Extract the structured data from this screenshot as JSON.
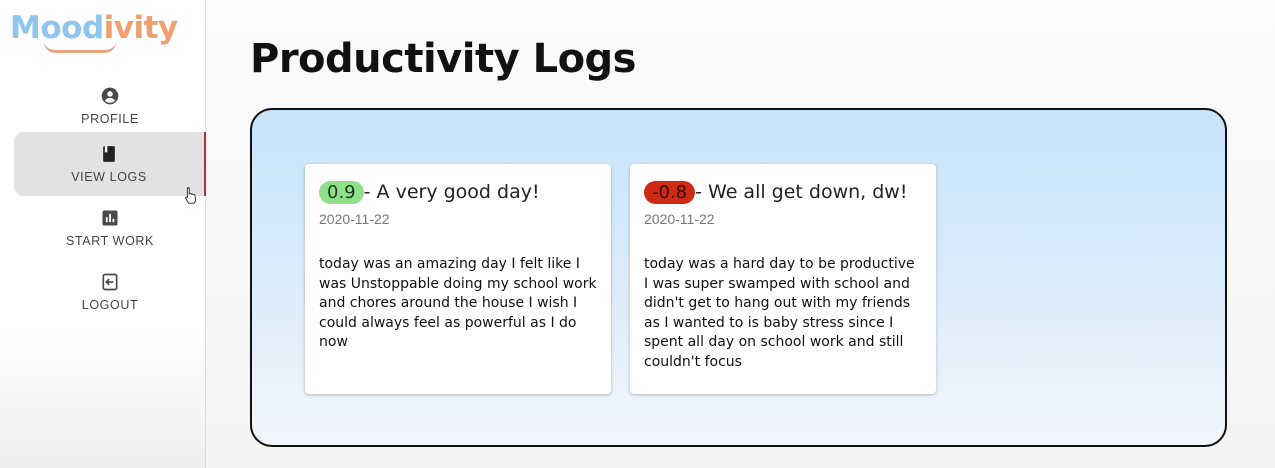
{
  "app": {
    "logo_part1": "Mood",
    "logo_part2": "ivity",
    "colors": {
      "logo_blue": "#8ec6ee",
      "logo_orange": "#f0a070",
      "active_indicator": "#b03040"
    }
  },
  "sidebar": {
    "items": [
      {
        "label": "PROFILE",
        "icon": "account-circle-icon"
      },
      {
        "label": "VIEW LOGS",
        "icon": "book-icon",
        "active": true
      },
      {
        "label": "START WORK",
        "icon": "bar-chart-icon"
      },
      {
        "label": "LOGOUT",
        "icon": "logout-icon"
      }
    ]
  },
  "main": {
    "title": "Productivity Logs",
    "logs": [
      {
        "score": "0.9",
        "score_sign": "positive",
        "score_color": "#8fe08a",
        "headline": "- A very good day!",
        "date": "2020-11-22",
        "text": "today was an amazing day I felt like I was Unstoppable doing my school work and chores around the house I wish I could always feel as powerful as I do now"
      },
      {
        "score": "-0.8",
        "score_sign": "negative",
        "score_color": "#cf2a14",
        "headline": "- We all get down, dw!",
        "date": "2020-11-22",
        "text": "today was a hard day to be productive I was super swamped with school and didn't get to hang out with my friends as I wanted to is baby stress since I spent all day on school work and still couldn't focus"
      }
    ]
  }
}
